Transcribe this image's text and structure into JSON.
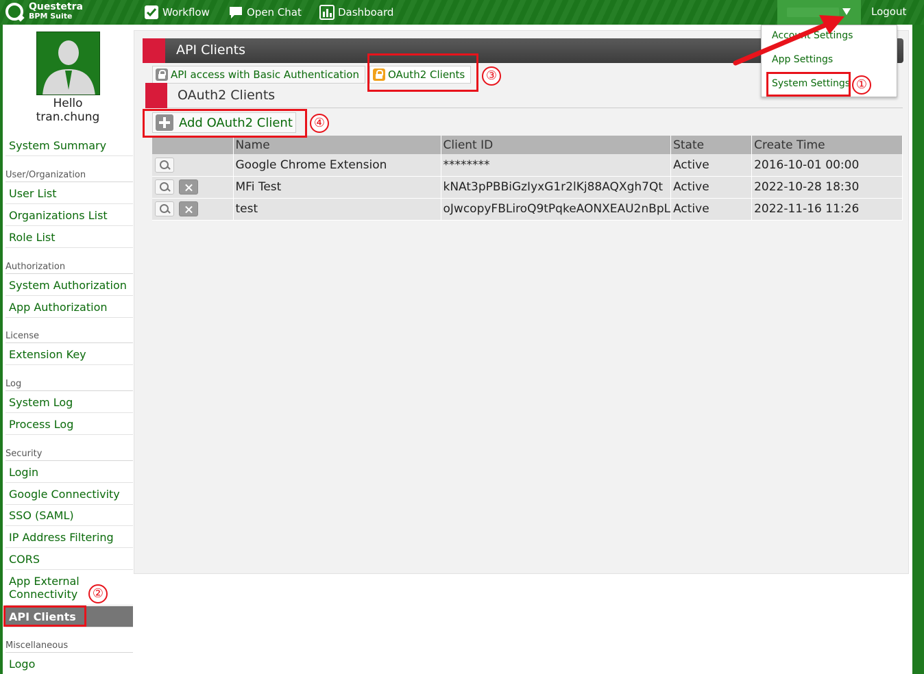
{
  "header": {
    "logo_line1": "Questetra",
    "logo_line2": "BPM Suite",
    "nav": [
      {
        "label": "Workflow",
        "icon": "check-icon"
      },
      {
        "label": "Open Chat",
        "icon": "chat-icon"
      },
      {
        "label": "Dashboard",
        "icon": "dashboard-icon"
      }
    ],
    "logout_label": "Logout"
  },
  "user_menu": {
    "items": [
      "Account Settings",
      "App Settings",
      "System Settings"
    ]
  },
  "sidebar": {
    "hello": "Hello",
    "username": "tran.chung",
    "items": {
      "system_summary": "System Summary",
      "cat_user_org": "User/Organization",
      "user_list": "User List",
      "organizations_list": "Organizations List",
      "role_list": "Role List",
      "cat_authorization": "Authorization",
      "system_authorization": "System Authorization",
      "app_authorization": "App Authorization",
      "cat_license": "License",
      "extension_key": "Extension Key",
      "cat_log": "Log",
      "system_log": "System Log",
      "process_log": "Process Log",
      "cat_security": "Security",
      "login": "Login",
      "google_connectivity": "Google Connectivity",
      "sso_saml": "SSO (SAML)",
      "ip_filtering": "IP Address Filtering",
      "cors": "CORS",
      "app_external_1": "App External",
      "app_external_2": "Connectivity",
      "api_clients": "API Clients",
      "cat_misc": "Miscellaneous",
      "logo": "Logo"
    }
  },
  "main": {
    "title": "API Clients",
    "tabs": [
      {
        "label": "API access with Basic Authentication"
      },
      {
        "label": "OAuth2 Clients"
      }
    ],
    "section_title": "OAuth2 Clients",
    "add_button_label": "Add OAuth2 Client",
    "table": {
      "headers": [
        "",
        "Name",
        "Client ID",
        "State",
        "Create Time"
      ],
      "rows": [
        {
          "name": "Google Chrome Extension",
          "client_id": "********",
          "state": "Active",
          "created": "2016-10-01 00:00"
        },
        {
          "name": "MFi Test",
          "client_id": "kNAt3pPBBiGzIyxG1r2lKj88AQXgh7Qt",
          "state": "Active",
          "created": "2022-10-28 18:30"
        },
        {
          "name": "test",
          "client_id": "oJwcopyFBLiroQ9tPqkeAONXEAU2nBpL",
          "state": "Active",
          "created": "2022-11-16 11:26"
        }
      ]
    }
  },
  "annotations": {
    "n1": "①",
    "n2": "②",
    "n3": "③",
    "n4": "④",
    "color": "#e8131b"
  },
  "colors": {
    "header_green": "#1d7a1d",
    "link_green": "#0a6a0a",
    "accent_red": "#d81b3a"
  }
}
